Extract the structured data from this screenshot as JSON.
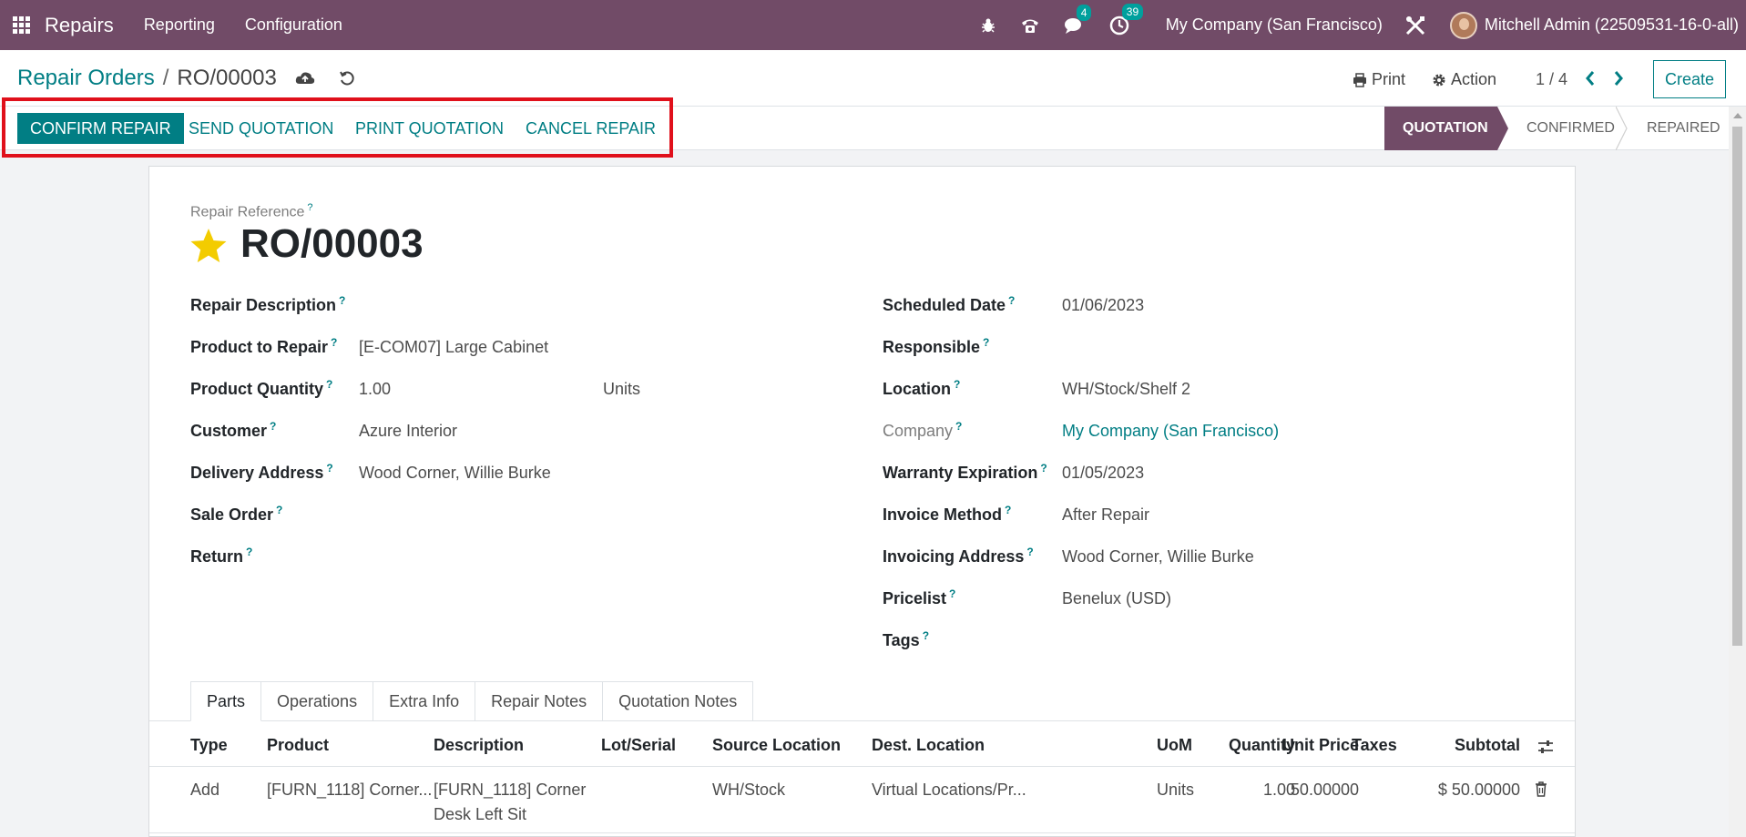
{
  "navbar": {
    "app_name": "Repairs",
    "menus": [
      "Reporting",
      "Configuration"
    ],
    "messages_count": "4",
    "activities_count": "39",
    "company": "My Company (San Francisco)",
    "user": "Mitchell Admin (22509531-16-0-all)",
    "bg_color": "#714b67"
  },
  "control": {
    "breadcrumb_parent": "Repair Orders",
    "breadcrumb_sep": "/",
    "breadcrumb_current": "RO/00003",
    "print_label": "Print",
    "action_label": "Action",
    "pager": "1 / 4",
    "create_label": "Create"
  },
  "statusbar": {
    "buttons": [
      "CONFIRM REPAIR",
      "SEND QUOTATION",
      "PRINT QUOTATION",
      "CANCEL REPAIR"
    ],
    "stages": [
      "QUOTATION",
      "CONFIRMED",
      "REPAIRED"
    ],
    "active_stage": "QUOTATION"
  },
  "form": {
    "reference_label": "Repair Reference",
    "reference": "RO/00003",
    "left": [
      {
        "label": "Repair Description",
        "value": ""
      },
      {
        "label": "Product to Repair",
        "value": "[E-COM07] Large Cabinet"
      },
      {
        "label": "Product Quantity",
        "value": "1.00",
        "unit": "Units"
      },
      {
        "label": "Customer",
        "value": "Azure Interior"
      },
      {
        "label": "Delivery Address",
        "value": "Wood Corner, Willie Burke"
      },
      {
        "label": "Sale Order",
        "value": ""
      },
      {
        "label": "Return",
        "value": ""
      }
    ],
    "right": [
      {
        "label": "Scheduled Date",
        "value": "01/06/2023"
      },
      {
        "label": "Responsible",
        "value": ""
      },
      {
        "label": "Location",
        "value": "WH/Stock/Shelf 2"
      },
      {
        "label": "Company",
        "value": "My Company (San Francisco)"
      },
      {
        "label": "Warranty Expiration",
        "value": "01/05/2023"
      },
      {
        "label": "Invoice Method",
        "value": "After Repair"
      },
      {
        "label": "Invoicing Address",
        "value": "Wood Corner, Willie Burke"
      },
      {
        "label": "Pricelist",
        "value": "Benelux (USD)"
      },
      {
        "label": "Tags",
        "value": ""
      }
    ],
    "help_marker": "?"
  },
  "tabs": [
    "Parts",
    "Operations",
    "Extra Info",
    "Repair Notes",
    "Quotation Notes"
  ],
  "table": {
    "headers": [
      "Type",
      "Product",
      "Description",
      "Lot/Serial",
      "Source Location",
      "Dest. Location",
      "Quantity",
      "UoM",
      "Unit Price",
      "Taxes",
      "Subtotal"
    ],
    "rows": [
      {
        "type": "Add",
        "product": "[FURN_1118] Corner...",
        "description_line1": "[FURN_1118] Corner",
        "description_line2": "Desk Left Sit",
        "lot": "",
        "source": "WH/Stock",
        "dest": "Virtual Locations/Pr...",
        "quantity": "1.00",
        "uom": "Units",
        "unit_price": "50.00000",
        "taxes": "",
        "subtotal": "$ 50.00000"
      }
    ]
  }
}
